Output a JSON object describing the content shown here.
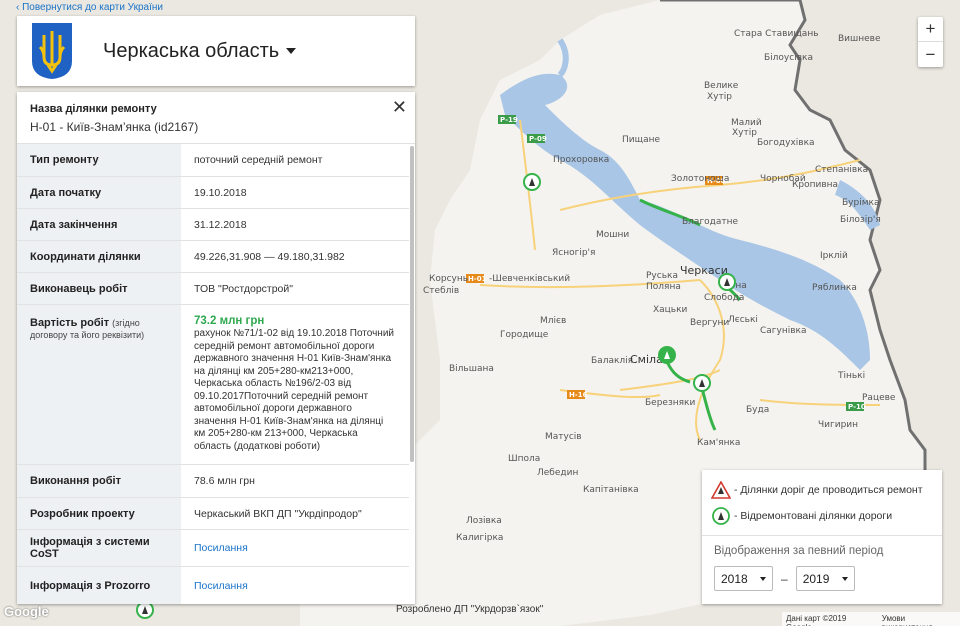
{
  "back_link": "Повернутися до карти України",
  "region": {
    "title": "Черкаська область"
  },
  "panel": {
    "section_label": "Назва ділянки ремонту",
    "section_value": "Н-01 - Київ-Знам’янка (id2167)",
    "rows": [
      {
        "key": "Тип ремонту",
        "value": "поточний середній ремонт"
      },
      {
        "key": "Дата початку",
        "value": "19.10.2018"
      },
      {
        "key": "Дата закінчення",
        "value": "31.12.2018"
      },
      {
        "key": "Координати ділянки",
        "value": "49.226,31.908 — 49.180,31.982"
      },
      {
        "key": "Виконавець робіт",
        "value": "ТОВ \"Ростдорстрой\""
      }
    ],
    "cost": {
      "key": "Вартість робіт",
      "key_note": "(згідно договору та його реквізити)",
      "amount": "73.2 млн грн",
      "description": "рахунок №71/1-02 від 19.10.2018 Поточний середній ремонт автомобільної дороги державного значення Н-01 Київ-Знам'янка на ділянці км 205+280-км213+000, Черкаська область №196/2-03 від 09.10.2017Поточний середній ремонт автомобільної дороги державного значення Н-01 Київ-Знам'янка на ділянці км 205+280-км 213+000, Черкаська область (додаткові роботи)"
    },
    "rows2": [
      {
        "key": "Виконання робіт",
        "value": "78.6 млн грн"
      },
      {
        "key": "Розробник проекту",
        "value": "Черкаський ВКП ДП \"Укрдіпродор\""
      }
    ],
    "link_rows": [
      {
        "key": "Інформація з системи CoST",
        "value": "Посилання"
      },
      {
        "key": "Інформація з Prozorro",
        "value": "Посилання"
      }
    ]
  },
  "zoom": {
    "in": "+",
    "out": "−"
  },
  "legend": {
    "repair_in_progress": "- Ділянки доріг де проводиться ремонт",
    "repaired": "- Відремонтовані ділянки дороги",
    "period_label": "Відображення за певний період",
    "from_year": "2018",
    "separator": "–",
    "to_year": "2019"
  },
  "map": {
    "places": [
      "Прохоровка",
      "Пищане",
      "Велике",
      "Хутір",
      "Малий",
      "Хутір",
      "Богодухівка",
      "Білоусівка",
      "Вишневе",
      "Кропивна",
      "Бурімка",
      "Ряблинка",
      "Стара Ставищань",
      "Степанівка",
      "Золотоноша",
      "Чорнобай",
      "Ірклій",
      "Білозір'я",
      "Благодатне",
      "Мошни",
      "Ясногір'я",
      "Черкаси",
      "Руська Поляна",
      "Чорна Слобода",
      "Хацьки",
      "Вергуни",
      "Лєські",
      "Сагунівка",
      "Корсунь",
      "Шевченківський",
      "Стеблів",
      "Млієв",
      "Городище",
      "Вільшана",
      "Балаклія",
      "Сміла",
      "Березняки",
      "Кам'янка",
      "Матусів",
      "Шпола",
      "Лебедин",
      "Капітанівка",
      "Калигірка",
      "Буда",
      "Чигирин",
      "Тінькі",
      "Рацеве",
      "Лозівка"
    ],
    "big_places": [
      "Черкаси",
      "Сміла"
    ],
    "roads": [
      "Р-19",
      "Р-09",
      "Н-08",
      "Н-01",
      "Н-16",
      "Р-10"
    ]
  },
  "footer": {
    "google": "Google",
    "made_by": "Розроблено ДП \"Укрдорзв`язок\"",
    "map_data": "Дані карт ©2019 Google",
    "terms": "Умови використання"
  }
}
